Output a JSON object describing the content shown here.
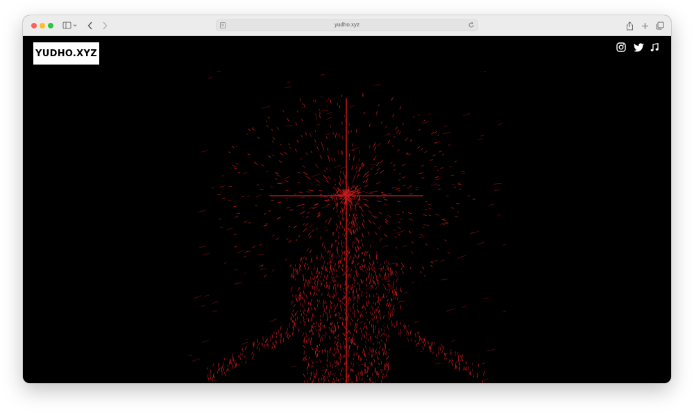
{
  "browser": {
    "url": "yudho.xyz"
  },
  "site": {
    "logo_text": "YUDHO.XYZ",
    "social_icons": [
      "instagram-icon",
      "twitter-icon",
      "music-note-icon"
    ]
  },
  "colors": {
    "background": "#000000",
    "art_red": "#c41a1a",
    "logo_bg": "#ffffff"
  }
}
